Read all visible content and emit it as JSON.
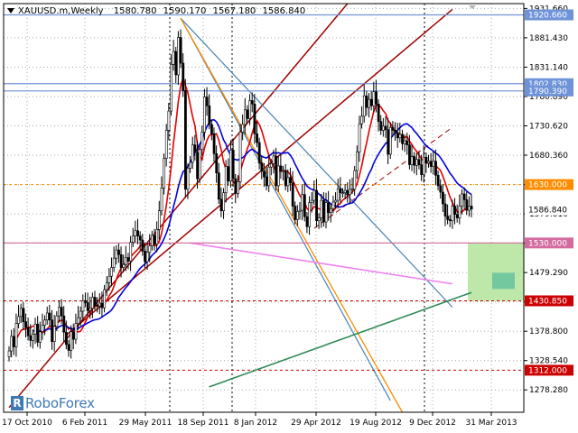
{
  "header": {
    "symbol_timeframe": "XAUUSD.m,Weekly",
    "ohlc": [
      "1580.780",
      "1590.170",
      "1567.180",
      "1586.840"
    ]
  },
  "brand": {
    "name": "RoboForex",
    "mark": "R"
  },
  "colors": {
    "background": "#ffffff",
    "grid": "#a7a7a7",
    "candle": "#000000",
    "ma_fast": "#e60000",
    "ma_mid": "#0000dd",
    "ma_slow": "#2e8b57",
    "trend_dark_red": "#a00000",
    "fan_blue": "#4682b4",
    "fan_orange": "#ff8c00",
    "pink_line": "#ee82ee",
    "support_line": "#d36b9f",
    "resistance_line": "#6f93d8",
    "target_zone": "#b6e6a0",
    "target_box": "#74c8a0"
  },
  "chart_data": {
    "type": "candlestick",
    "title": "XAUUSD.m,Weekly",
    "ylim": [
      1240,
      1940
    ],
    "y_ticks": [
      "1931.660",
      "1881.430",
      "1831.140",
      "1780.890",
      "1730.620",
      "1680.360",
      "1630.080",
      "1579.810",
      "1529.540",
      "1479.290",
      "1429.020",
      "1378.800",
      "1328.540",
      "1278.280"
    ],
    "x_ticks": [
      "17 Oct 2010",
      "6 Feb 2011",
      "29 May 2011",
      "18 Sep 2011",
      "8 Jan 2012",
      "29 Apr 2012",
      "19 Aug 2012",
      "9 Dec 2012",
      "31 Mar 2013"
    ],
    "grid": true,
    "levels": [
      {
        "price": 1920.66,
        "label": "1920.660",
        "color": "#6f93d8",
        "style": "solid"
      },
      {
        "price": 1802.83,
        "label": "1802.830",
        "color": "#6f93d8",
        "style": "solid"
      },
      {
        "price": 1790.39,
        "label": "1790.390",
        "color": "#6f93d8",
        "style": "solid"
      },
      {
        "price": 1630.0,
        "label": "1630.000",
        "color": "#ff8c00",
        "style": "dashed"
      },
      {
        "price": 1530.0,
        "label": "1530.000",
        "color": "#d36b9f",
        "style": "solid"
      },
      {
        "price": 1430.85,
        "label": "1430.850",
        "color": "#cc0000",
        "style": "dashed"
      },
      {
        "price": 1312.0,
        "label": "1312.000",
        "color": "#cc0000",
        "style": "dashed"
      }
    ],
    "current_price": {
      "price": 1586.84,
      "label": "1586.840"
    },
    "candles_close": [
      1345,
      1370,
      1352,
      1392,
      1404,
      1418,
      1395,
      1385,
      1371,
      1363,
      1374,
      1391,
      1360,
      1378,
      1389,
      1398,
      1410,
      1398,
      1361,
      1387,
      1405,
      1420,
      1405,
      1377,
      1356,
      1346,
      1378,
      1365,
      1392,
      1402,
      1413,
      1431,
      1428,
      1414,
      1418,
      1437,
      1423,
      1422,
      1427,
      1419,
      1450,
      1462,
      1473,
      1488,
      1504,
      1518,
      1510,
      1488,
      1493,
      1505,
      1499,
      1531,
      1542,
      1551,
      1542,
      1535,
      1516,
      1498,
      1514,
      1525,
      1543,
      1528,
      1553,
      1585,
      1624,
      1675,
      1723,
      1756,
      1836,
      1858,
      1818,
      1882,
      1838,
      1791,
      1622,
      1658,
      1668,
      1698,
      1685,
      1640,
      1690,
      1720,
      1780,
      1765,
      1733,
      1717,
      1683,
      1650,
      1605,
      1585,
      1616,
      1661,
      1636,
      1689,
      1640,
      1615,
      1635,
      1720,
      1733,
      1758,
      1743,
      1774,
      1768,
      1717,
      1702,
      1667,
      1653,
      1643,
      1628,
      1660,
      1666,
      1679,
      1628,
      1662,
      1654,
      1654,
      1628,
      1642,
      1633,
      1593,
      1570,
      1584,
      1586,
      1613,
      1575,
      1558,
      1599,
      1603,
      1620,
      1568,
      1573,
      1603,
      1566,
      1599,
      1582,
      1589,
      1600,
      1603,
      1623,
      1616,
      1616,
      1620,
      1613,
      1622,
      1622,
      1654,
      1686,
      1734,
      1747,
      1782,
      1762,
      1776,
      1765,
      1789,
      1768,
      1738,
      1723,
      1730,
      1724,
      1682,
      1728,
      1723,
      1719,
      1710,
      1716,
      1700,
      1705,
      1698,
      1664,
      1678,
      1663,
      1673,
      1664,
      1647,
      1677,
      1667,
      1670,
      1661,
      1670,
      1646,
      1628,
      1617,
      1597,
      1576,
      1570,
      1568,
      1593,
      1579,
      1573,
      1593,
      1614,
      1604,
      1586,
      1593,
      1588
    ]
  }
}
